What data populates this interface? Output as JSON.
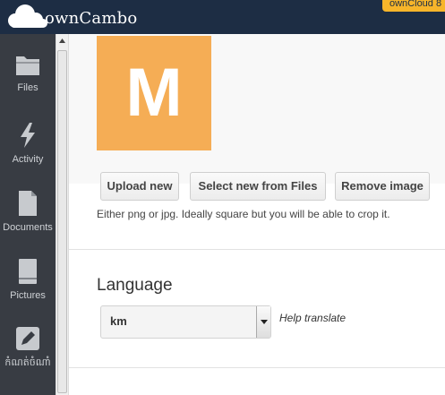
{
  "header": {
    "app_name": "ownCambo",
    "update_notice": "ownCloud 8"
  },
  "sidebar": {
    "items": [
      {
        "label": "Files",
        "icon": "folder-icon"
      },
      {
        "label": "Activity",
        "icon": "lightning-icon"
      },
      {
        "label": "Documents",
        "icon": "document-icon"
      },
      {
        "label": "Pictures",
        "icon": "picture-icon"
      },
      {
        "label": "កំណត់ចំណាំ",
        "icon": "pencil-icon"
      }
    ]
  },
  "profile_picture": {
    "avatar_letter": "M",
    "avatar_color": "#f5ad55",
    "upload_new_label": "Upload new",
    "select_from_files_label": "Select new from Files",
    "remove_image_label": "Remove image",
    "hint": "Either png or jpg. Ideally square but you will be able to crop it."
  },
  "language": {
    "title": "Language",
    "selected": "km",
    "help_translate": "Help translate"
  },
  "colors": {
    "header_bg": "#1d2d44",
    "sidebar_bg": "#383c43",
    "accent": "#f7b52a"
  }
}
